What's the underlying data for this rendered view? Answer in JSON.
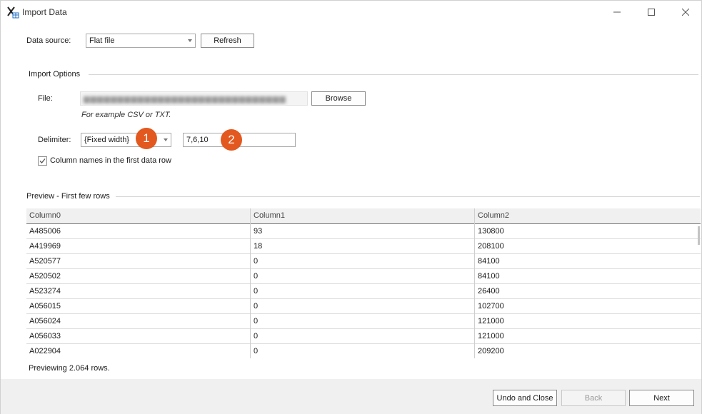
{
  "window": {
    "title": "Import Data",
    "controls": {
      "minimize_icon": "minimize-icon",
      "maximize_icon": "maximize-icon",
      "close_icon": "close-icon"
    }
  },
  "source": {
    "label": "Data source:",
    "value": "Flat file",
    "refresh_label": "Refresh"
  },
  "import_options": {
    "heading": "Import Options",
    "file_label": "File:",
    "browse_label": "Browse",
    "file_hint": "For example CSV or TXT.",
    "delimiter_label": "Delimiter:",
    "delimiter_value": "{Fixed width}",
    "widths_value": "7,6,10",
    "column_names_label": "Column names in the first data row",
    "column_names_checked": true,
    "badges": [
      "1",
      "2"
    ]
  },
  "preview": {
    "heading": "Preview - First few rows",
    "columns": [
      "Column0",
      "Column1",
      "Column2"
    ],
    "rows": [
      [
        "A485006",
        "93",
        "130800"
      ],
      [
        "A419969",
        "18",
        "208100"
      ],
      [
        "A520577",
        "0",
        "84100"
      ],
      [
        "A520502",
        "0",
        "84100"
      ],
      [
        "A523274",
        "0",
        "26400"
      ],
      [
        "A056015",
        "0",
        "102700"
      ],
      [
        "A056024",
        "0",
        "121000"
      ],
      [
        "A056033",
        "0",
        "121000"
      ],
      [
        "A022904",
        "0",
        "209200"
      ]
    ],
    "status": "Previewing 2.064 rows."
  },
  "footer": {
    "undo_close_label": "Undo and Close",
    "back_label": "Back",
    "next_label": "Next"
  },
  "colors": {
    "accent_badge": "#e2581e",
    "footer_bg": "#f0f0f0"
  }
}
